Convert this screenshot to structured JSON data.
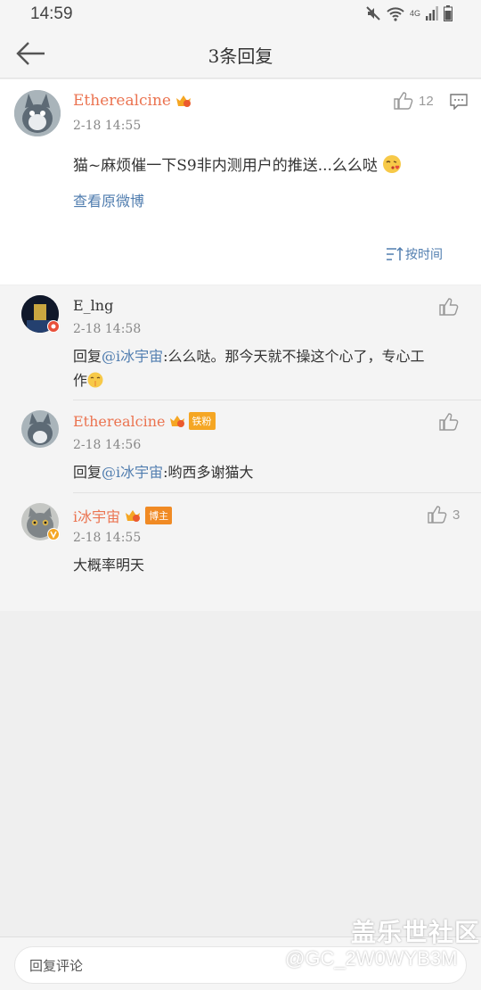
{
  "status": {
    "time": "14:59",
    "network": "4G"
  },
  "nav": {
    "title": "3条回复"
  },
  "main_comment": {
    "username": "Etherealcine",
    "timestamp": "2-18 14:55",
    "likes": "12",
    "text": "猫~麻烦催一下S9非内测用户的推送...么么哒",
    "view_original": "查看原微博",
    "sort_label": "按时间"
  },
  "replies": [
    {
      "username": "E_lng",
      "timestamp": "2-18 14:58",
      "prefix": "回复",
      "mention": "@i冰宇宙",
      "text": ":么么哒。那今天就不操这个心了，专心工",
      "text2": "作"
    },
    {
      "username": "Etherealcine",
      "tag": "铁粉",
      "timestamp": "2-18 14:56",
      "prefix": "回复",
      "mention": "@i冰宇宙",
      "text": ":哟西多谢猫大"
    },
    {
      "username": "i冰宇宙",
      "tag": "博主",
      "timestamp": "2-18 14:55",
      "likes": "3",
      "text": "大概率明天"
    }
  ],
  "bottom": {
    "placeholder": "回复评论"
  },
  "watermark": {
    "line1": "盖乐世社区",
    "line2": "@GC_2W0WYB3M"
  },
  "colors": {
    "username": "#eb7350",
    "link": "#507daf",
    "tag_fan": "#f5a623",
    "tag_author": "#f08a24"
  }
}
